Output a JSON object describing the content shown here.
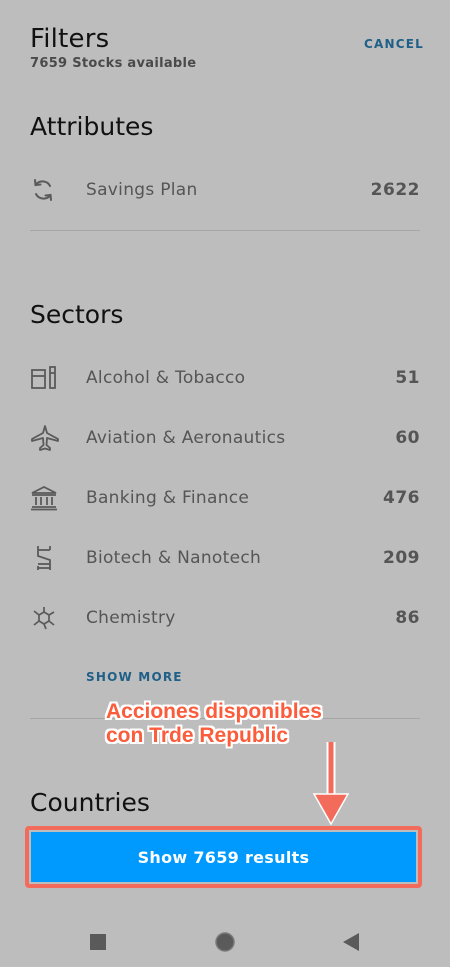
{
  "header": {
    "title": "Filters",
    "subtitle": "7659 Stocks available",
    "cancel_label": "CANCEL"
  },
  "attributes": {
    "title": "Attributes",
    "items": [
      {
        "icon": "refresh-icon",
        "label": "Savings Plan",
        "count": "2622"
      }
    ]
  },
  "sectors": {
    "title": "Sectors",
    "items": [
      {
        "icon": "bottle-glass-icon",
        "label": "Alcohol & Tobacco",
        "count": "51"
      },
      {
        "icon": "airplane-icon",
        "label": "Aviation & Aeronautics",
        "count": "60"
      },
      {
        "icon": "bank-icon",
        "label": "Banking & Finance",
        "count": "476"
      },
      {
        "icon": "dna-icon",
        "label": "Biotech & Nanotech",
        "count": "209"
      },
      {
        "icon": "molecule-icon",
        "label": "Chemistry",
        "count": "86"
      }
    ],
    "show_more_label": "SHOW MORE"
  },
  "countries": {
    "title": "Countries"
  },
  "annotation": {
    "line1": "Acciones disponibles",
    "line2": "con Trde Republic",
    "color": "#fa5c3c"
  },
  "cta": {
    "label": "Show 7659 results",
    "color": "#009afe"
  },
  "accent_color": "#1f5f88"
}
